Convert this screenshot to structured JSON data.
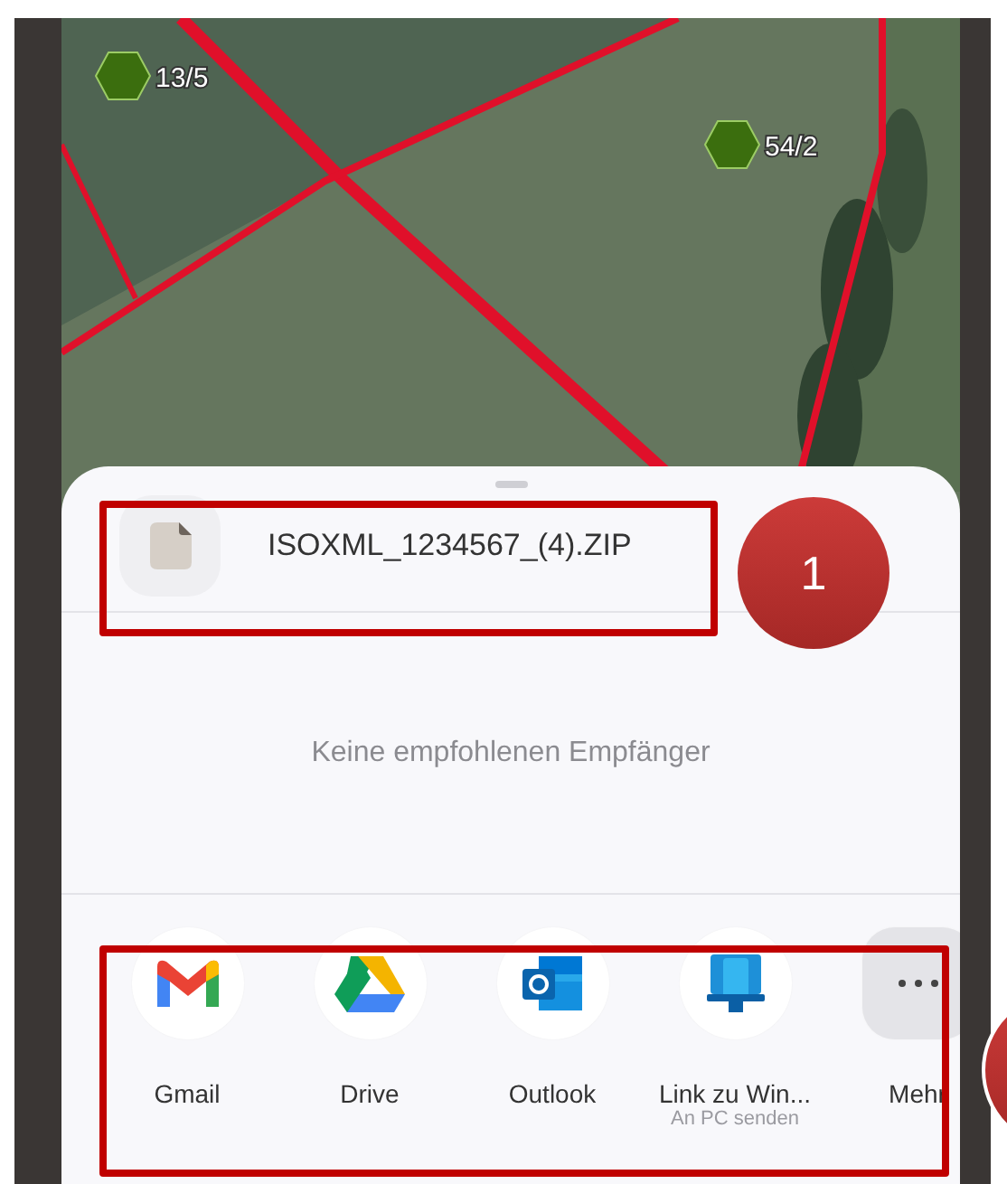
{
  "map": {
    "markers": [
      {
        "label": "13/5"
      },
      {
        "label": "54/2"
      }
    ]
  },
  "share_sheet": {
    "file_name": "ISOXML_1234567_(4).ZIP",
    "empty_message": "Keine empfohlenen Empfänger",
    "apps": [
      {
        "kind": "gmail",
        "label": "Gmail"
      },
      {
        "kind": "drive",
        "label": "Drive"
      },
      {
        "kind": "outlook",
        "label": "Outlook"
      },
      {
        "kind": "link-to-windows",
        "label": "Link zu Win...",
        "sublabel": "An PC senden"
      },
      {
        "kind": "more",
        "label": "Mehr"
      }
    ]
  },
  "annotations": [
    {
      "label": "1"
    }
  ]
}
